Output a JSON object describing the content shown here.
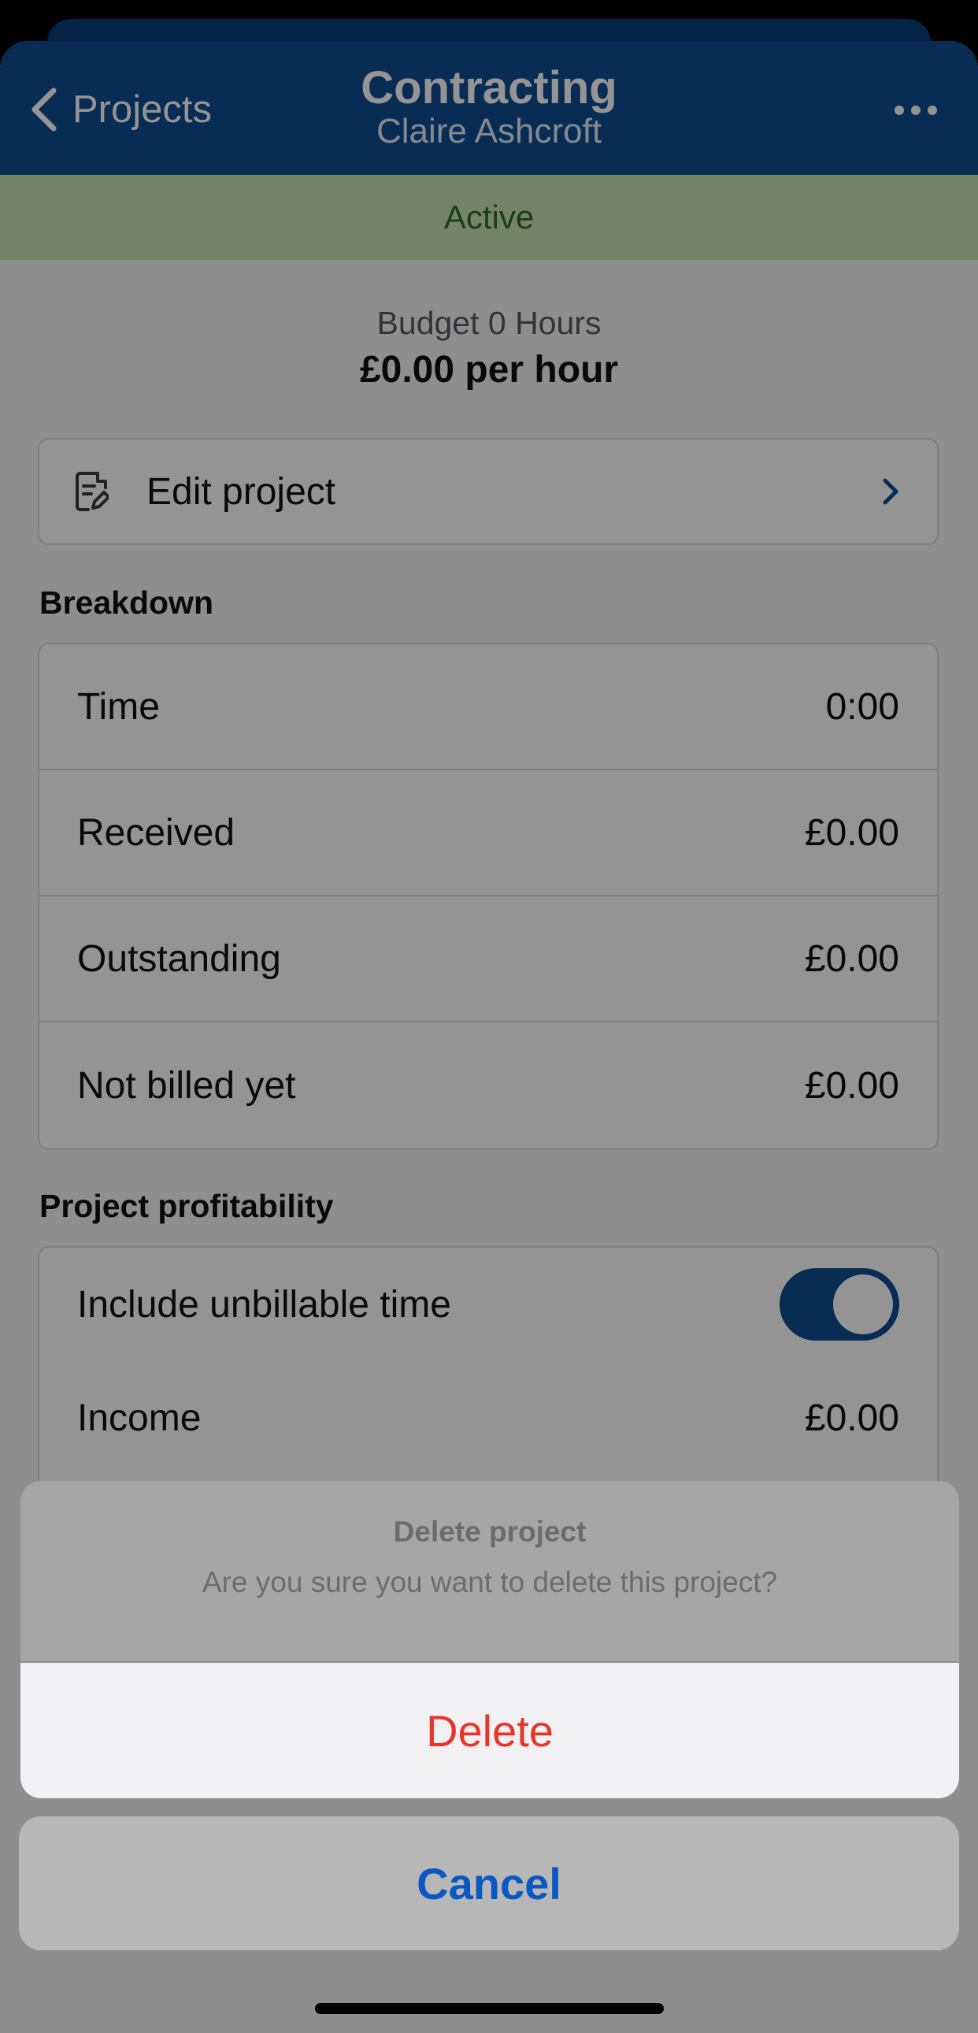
{
  "nav": {
    "back_label": "Projects",
    "title": "Contracting",
    "subtitle": "Claire Ashcroft"
  },
  "status": {
    "label": "Active",
    "color": "#2f6d22",
    "background": "#c6e3b9"
  },
  "budget": {
    "hours_text": "Budget 0 Hours",
    "rate_text": "£0.00 per hour"
  },
  "edit_project": {
    "label": "Edit project"
  },
  "breakdown": {
    "title": "Breakdown",
    "rows": [
      {
        "label": "Time",
        "value": "0:00"
      },
      {
        "label": "Received",
        "value": "£0.00"
      },
      {
        "label": "Outstanding",
        "value": "£0.00"
      },
      {
        "label": "Not billed yet",
        "value": "£0.00"
      }
    ]
  },
  "profitability": {
    "title": "Project profitability",
    "include_unbillable_label": "Include unbillable time",
    "include_unbillable_on": true,
    "income_label": "Income",
    "income_value": "£0.00"
  },
  "action_sheet": {
    "title": "Delete project",
    "message": "Are you sure you want to delete this project?",
    "destructive_label": "Delete",
    "cancel_label": "Cancel"
  },
  "colors": {
    "brand": "#0e4c92",
    "destructive": "#e5362b",
    "cancel": "#0a58c2"
  },
  "icons": {
    "back": "chevron-left-icon",
    "more": "ellipsis-icon",
    "edit": "document-edit-icon",
    "disclosure": "chevron-right-icon"
  }
}
